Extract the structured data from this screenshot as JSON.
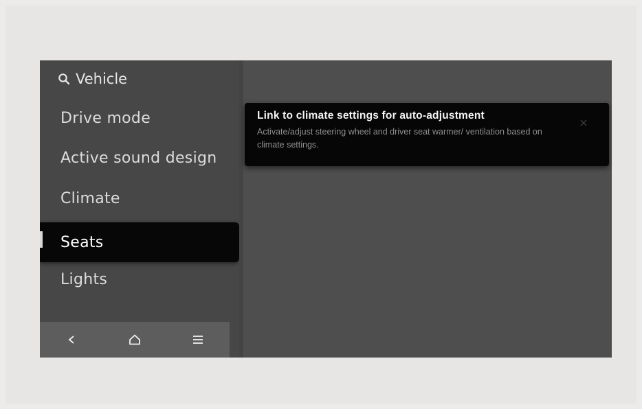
{
  "sidebar": {
    "search_label": "Vehicle",
    "items": [
      {
        "label": "Drive mode"
      },
      {
        "label": "Active sound design"
      },
      {
        "label": "Climate"
      },
      {
        "label": "Seats",
        "selected": true
      },
      {
        "label": "Lights"
      }
    ]
  },
  "bottom_bar": {
    "icons": [
      "back-icon",
      "home-icon",
      "menu-icon"
    ]
  },
  "content": {
    "card": {
      "title": "Link to climate settings for auto-adjustment",
      "description": "Activate/adjust steering wheel and driver seat warmer/ ventilation based on climate settings."
    }
  },
  "colors": {
    "screen_bg": "#4b4b4b",
    "selected_bg": "#070707",
    "text": "#dcdcdc"
  }
}
